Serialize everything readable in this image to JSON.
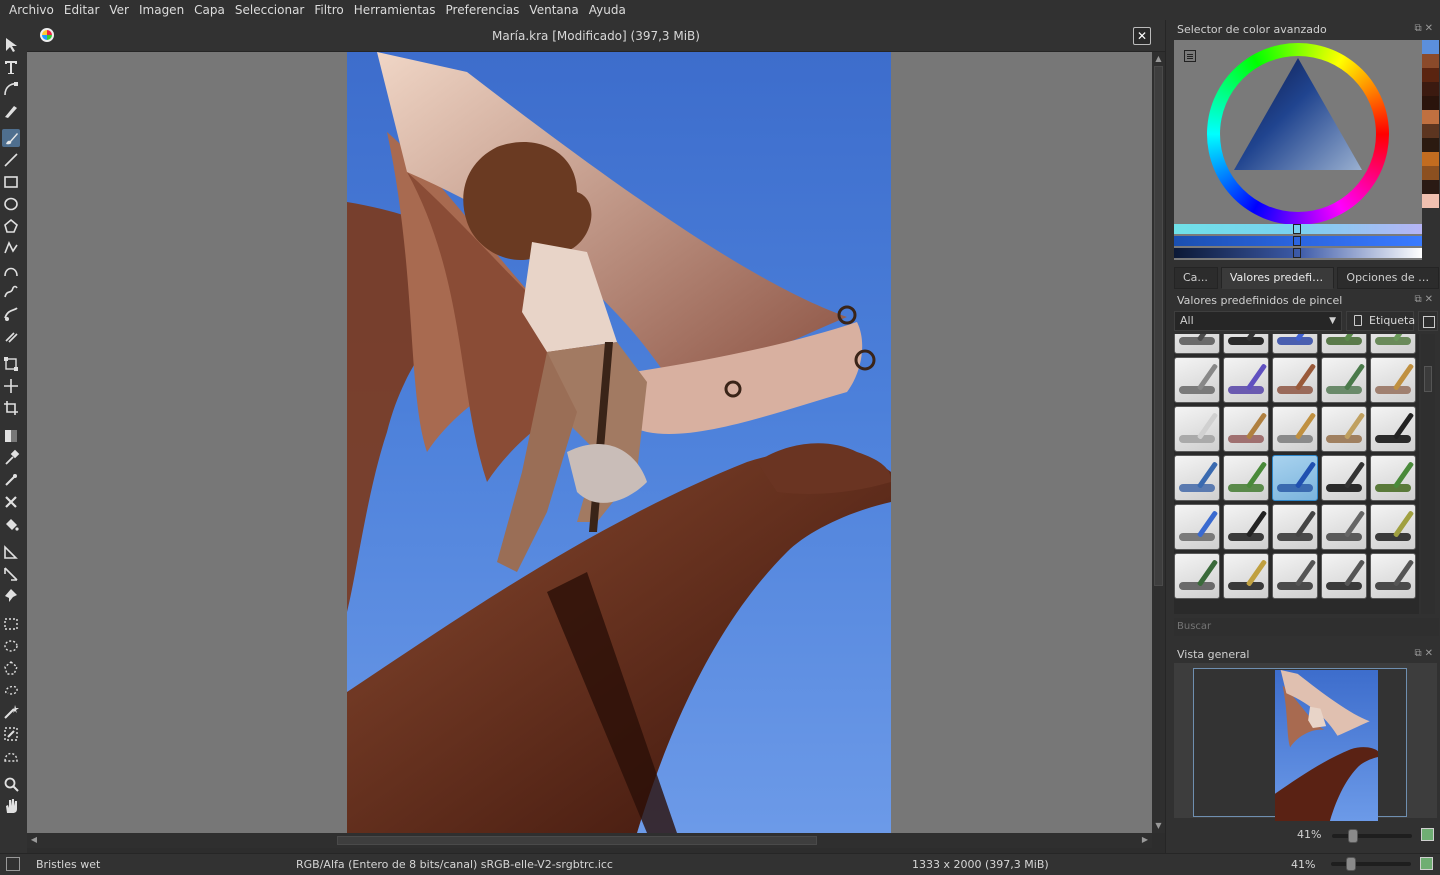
{
  "menu": [
    "Archivo",
    "Editar",
    "Ver",
    "Imagen",
    "Capa",
    "Seleccionar",
    "Filtro",
    "Herramientas",
    "Preferencias",
    "Ventana",
    "Ayuda"
  ],
  "document": {
    "title": "María.kra [Modificado]  (397,3 MiB)",
    "close_label": "✕"
  },
  "toolbox": [
    {
      "name": "select-shapes-tool",
      "icon": "pointer-icon"
    },
    {
      "name": "text-tool",
      "icon": "text-icon"
    },
    {
      "name": "edit-shapes-tool",
      "icon": "edit-shape-icon"
    },
    {
      "name": "calligraphy-tool",
      "icon": "calligraphy-icon"
    },
    {
      "name": "freehand-brush-tool",
      "icon": "brush-icon",
      "active": true
    },
    {
      "name": "line-tool",
      "icon": "line-icon"
    },
    {
      "name": "rectangle-tool",
      "icon": "rectangle-icon"
    },
    {
      "name": "ellipse-tool",
      "icon": "ellipse-icon"
    },
    {
      "name": "polygon-tool",
      "icon": "polygon-icon"
    },
    {
      "name": "polyline-tool",
      "icon": "polyline-icon"
    },
    {
      "name": "bezier-curve-tool",
      "icon": "bezier-icon"
    },
    {
      "name": "freehand-path-tool",
      "icon": "freehand-path-icon"
    },
    {
      "name": "dynamic-brush-tool",
      "icon": "dynamic-brush-icon"
    },
    {
      "name": "multibrush-tool",
      "icon": "multibrush-icon"
    },
    {
      "name": "transform-tool",
      "icon": "transform-icon"
    },
    {
      "name": "move-tool",
      "icon": "move-icon"
    },
    {
      "name": "crop-tool",
      "icon": "crop-icon"
    },
    {
      "name": "gradient-tool",
      "icon": "gradient-icon"
    },
    {
      "name": "color-sampler-tool",
      "icon": "eyedropper-icon"
    },
    {
      "name": "colorize-mask-tool",
      "icon": "colorize-icon"
    },
    {
      "name": "smart-patch-tool",
      "icon": "patch-icon"
    },
    {
      "name": "fill-tool",
      "icon": "bucket-icon"
    },
    {
      "name": "assistant-tool",
      "icon": "assistant-icon"
    },
    {
      "name": "measure-tool",
      "icon": "measure-icon"
    },
    {
      "name": "reference-images-tool",
      "icon": "pin-icon"
    },
    {
      "name": "rectangular-selection-tool",
      "icon": "rect-select-icon"
    },
    {
      "name": "elliptical-selection-tool",
      "icon": "ellipse-select-icon"
    },
    {
      "name": "polygonal-selection-tool",
      "icon": "polygon-select-icon"
    },
    {
      "name": "freehand-selection-tool",
      "icon": "lasso-icon"
    },
    {
      "name": "contiguous-selection-tool",
      "icon": "magic-wand-icon"
    },
    {
      "name": "similar-color-selection-tool",
      "icon": "similar-select-icon"
    },
    {
      "name": "bezier-selection-tool",
      "icon": "bezier-select-icon"
    },
    {
      "name": "zoom-tool",
      "icon": "zoom-icon"
    },
    {
      "name": "pan-tool",
      "icon": "hand-icon"
    }
  ],
  "color_panel": {
    "title": "Selector de color avanzado",
    "swatches": [
      "#5b8fdc",
      "#8b4a2a",
      "#5a2410",
      "#3b1a10",
      "#2a140c",
      "#c07040",
      "#5c3520",
      "#2b1a10",
      "#c26c20",
      "#8c5020",
      "#2a1a14",
      "#f0c0b0"
    ]
  },
  "tabs": [
    {
      "label": "Ca...",
      "active": false
    },
    {
      "label": "Valores predefinid...",
      "active": true
    },
    {
      "label": "Opciones de la ...",
      "active": false
    }
  ],
  "presets": {
    "title": "Valores predefinidos de pincel",
    "filter_value": "All",
    "tag_label": "Etiqueta",
    "search_placeholder": "Buscar",
    "items": [
      {
        "stroke": "#6a6a6a",
        "stick": "#4a4a4a"
      },
      {
        "stroke": "#2a2a2a",
        "stick": "#333333"
      },
      {
        "stroke": "#4a5fb0",
        "stick": "#4060d0"
      },
      {
        "stroke": "#5a7a4a",
        "stick": "#5a8a4a"
      },
      {
        "stroke": "#6a8a5a",
        "stick": "#6a9a5a"
      },
      {
        "stroke": "#7a7a7a",
        "stick": "#888888"
      },
      {
        "stroke": "#6a5ab0",
        "stick": "#6050c0"
      },
      {
        "stroke": "#9a6a5a",
        "stick": "#9a5a3a"
      },
      {
        "stroke": "#6a8a6a",
        "stick": "#4a7a4a"
      },
      {
        "stroke": "#a08070",
        "stick": "#c09040"
      },
      {
        "stroke": "#aaaaaa",
        "stick": "#d0d0d0"
      },
      {
        "stroke": "#a07070",
        "stick": "#b08040"
      },
      {
        "stroke": "#8a8a8a",
        "stick": "#c09040"
      },
      {
        "stroke": "#a08060",
        "stick": "#c0a060"
      },
      {
        "stroke": "#2a2a2a",
        "stick": "#222222"
      },
      {
        "stroke": "#5a7ab0",
        "stick": "#3a6ab0"
      },
      {
        "stroke": "#5a8a4a",
        "stick": "#4a8a3a"
      },
      {
        "stroke": "#3a6ab0",
        "stick": "#2050b0",
        "selected": true
      },
      {
        "stroke": "#2a2a2a",
        "stick": "#333333"
      },
      {
        "stroke": "#5a7a3a",
        "stick": "#4a8a3a"
      },
      {
        "stroke": "#7a7a7a",
        "stick": "#3a6ad0"
      },
      {
        "stroke": "#3a3a3a",
        "stick": "#222222"
      },
      {
        "stroke": "#4a4a4a",
        "stick": "#444444"
      },
      {
        "stroke": "#5a5a5a",
        "stick": "#666666"
      },
      {
        "stroke": "#3a3a3a",
        "stick": "#a0a040"
      },
      {
        "stroke": "#6a6a6a",
        "stick": "#3a6a3a"
      },
      {
        "stroke": "#3a3a3a",
        "stick": "#c0a040"
      },
      {
        "stroke": "#4a4a4a",
        "stick": "#555555"
      },
      {
        "stroke": "#3a3a3a",
        "stick": "#555555"
      },
      {
        "stroke": "#4a4a4a",
        "stick": "#555555"
      }
    ]
  },
  "overview": {
    "title": "Vista general",
    "zoom": "41%"
  },
  "status": {
    "brush": "Bristles wet",
    "colorspace": "RGB/Alfa (Entero de 8 bits/canal)  sRGB-elle-V2-srgbtrc.icc",
    "dimensions": "1333 x 2000 (397,3 MiB)",
    "zoom": "41%"
  },
  "panel_buttons": "⧉✕"
}
